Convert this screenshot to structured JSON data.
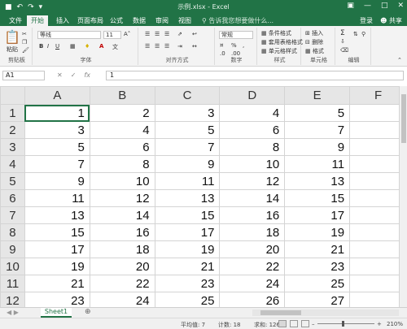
{
  "window": {
    "title": "示例.xlsx - Excel"
  },
  "menu": {
    "tabs": [
      "文件",
      "开始",
      "插入",
      "页面布局",
      "公式",
      "数据",
      "审阅",
      "视图"
    ],
    "active_tab": "开始",
    "tell_me": "告诉我您想要做什么...",
    "sign_in": "登录",
    "share": "共享"
  },
  "ribbon": {
    "clipboard": {
      "paste": "粘贴",
      "label": "剪贴板"
    },
    "font": {
      "name": "等线",
      "size": "11",
      "bold": "B",
      "italic": "I",
      "underline": "U",
      "label": "字体"
    },
    "alignment": {
      "label": "对齐方式"
    },
    "number": {
      "format": "常规",
      "percent": "%",
      "label": "数字"
    },
    "styles": {
      "conditional": "条件格式",
      "table": "套用表格格式",
      "cell": "单元格样式",
      "label": "样式"
    },
    "cells": {
      "insert": "插入",
      "delete": "删除",
      "format": "格式",
      "label": "单元格"
    },
    "editing": {
      "label": "编辑"
    }
  },
  "formula_bar": {
    "name_box": "A1",
    "fx": "fx",
    "value": "1"
  },
  "sheet": {
    "columns": [
      "A",
      "B",
      "C",
      "D",
      "E",
      "F"
    ],
    "rows": [
      {
        "num": "1",
        "cells": [
          "1",
          "2",
          "3",
          "4",
          "5",
          ""
        ]
      },
      {
        "num": "2",
        "cells": [
          "3",
          "4",
          "5",
          "6",
          "7",
          ""
        ]
      },
      {
        "num": "3",
        "cells": [
          "5",
          "6",
          "7",
          "8",
          "9",
          ""
        ]
      },
      {
        "num": "4",
        "cells": [
          "7",
          "8",
          "9",
          "10",
          "11",
          ""
        ]
      },
      {
        "num": "5",
        "cells": [
          "9",
          "10",
          "11",
          "12",
          "13",
          ""
        ]
      },
      {
        "num": "6",
        "cells": [
          "11",
          "12",
          "13",
          "14",
          "15",
          ""
        ]
      },
      {
        "num": "7",
        "cells": [
          "13",
          "14",
          "15",
          "16",
          "17",
          ""
        ]
      },
      {
        "num": "8",
        "cells": [
          "15",
          "16",
          "17",
          "18",
          "19",
          ""
        ]
      },
      {
        "num": "9",
        "cells": [
          "17",
          "18",
          "19",
          "20",
          "21",
          ""
        ]
      },
      {
        "num": "10",
        "cells": [
          "19",
          "20",
          "21",
          "22",
          "23",
          ""
        ]
      },
      {
        "num": "11",
        "cells": [
          "21",
          "22",
          "23",
          "24",
          "25",
          ""
        ]
      },
      {
        "num": "12",
        "cells": [
          "23",
          "24",
          "25",
          "26",
          "27",
          ""
        ]
      }
    ],
    "tabs": [
      "Sheet1"
    ]
  },
  "status": {
    "average": "平均值: 7",
    "count": "计数: 18",
    "sum": "求和: 126",
    "zoom": "210%"
  }
}
